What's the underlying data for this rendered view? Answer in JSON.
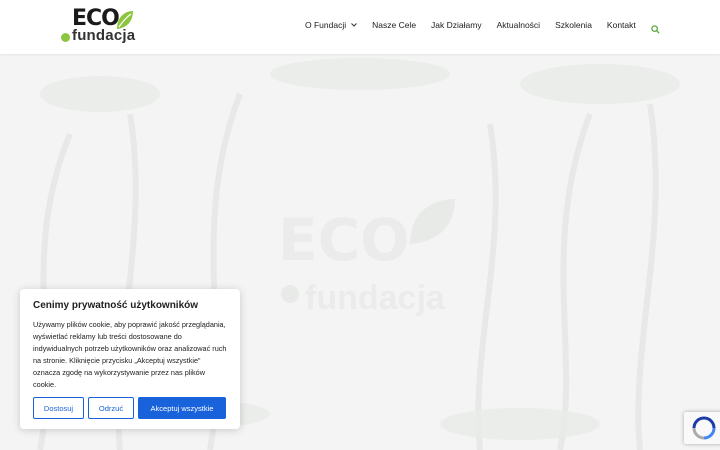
{
  "header": {
    "logo": {
      "eco": "ECO",
      "fundacja": "fundacja"
    },
    "nav": [
      {
        "label": "O Fundacji",
        "has_dropdown": true
      },
      {
        "label": "Nasze Cele"
      },
      {
        "label": "Jak Działamy"
      },
      {
        "label": "Aktualności"
      },
      {
        "label": "Szkolenia"
      },
      {
        "label": "Kontakt"
      }
    ],
    "search_icon": "search-icon"
  },
  "hero": {
    "watermark_logo": "ECO fundacja"
  },
  "cookie_banner": {
    "title": "Cenimy prywatność użytkowników",
    "text": "Używamy plików cookie, aby poprawić jakość przeglądania, wyświetlać reklamy lub treści dostosowane do indywidualnych potrzeb użytkowników oraz analizować ruch na stronie. Kliknięcie przycisku „Akceptuj wszystkie” oznacza zgodę na wykorzystywanie przez nas plików cookie.",
    "buttons": {
      "customize": "Dostosuj",
      "reject": "Odrzuć",
      "accept": "Akceptuj wszystkie"
    }
  },
  "recaptcha": {
    "icon": "recaptcha-icon"
  },
  "colors": {
    "brand_green": "#8cc63f",
    "accent_blue": "#1863dc",
    "nav_search": "#5aa83c"
  }
}
